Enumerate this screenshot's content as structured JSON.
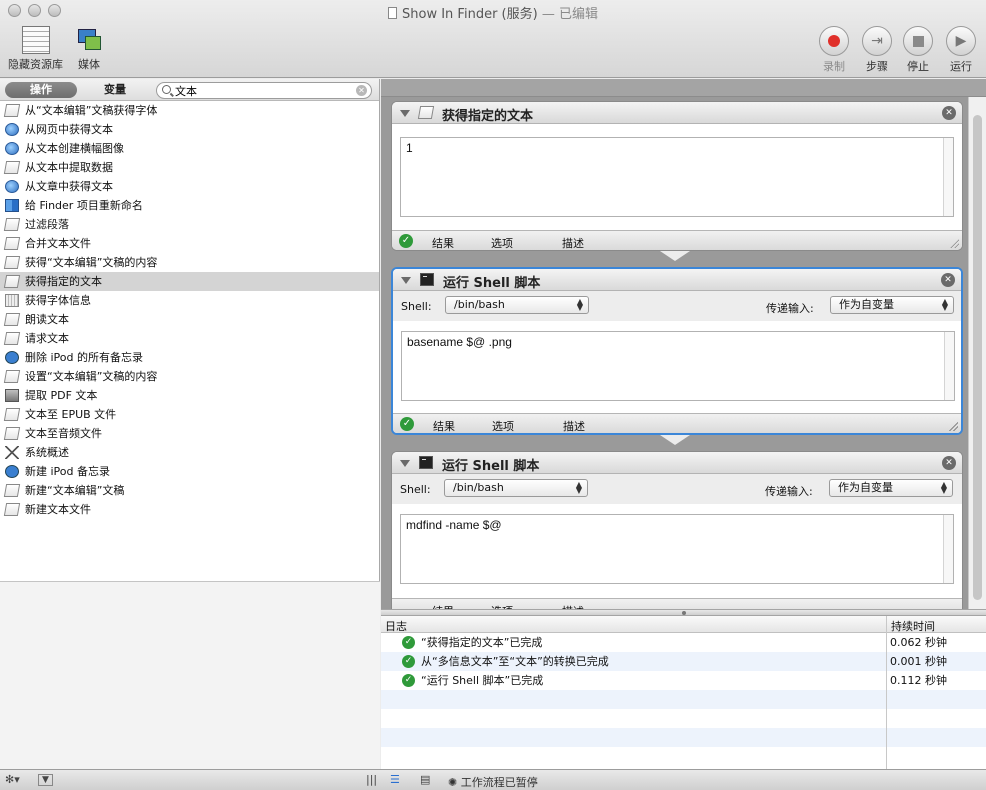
{
  "window": {
    "title": "Show In Finder (服务)",
    "subtitle": "— 已编辑"
  },
  "toolbar": {
    "left": [
      {
        "label": "隐藏资源库",
        "icon": "library-icon"
      },
      {
        "label": "媒体",
        "icon": "media-icon"
      }
    ],
    "right": [
      {
        "label": "录制",
        "icon": "record-icon"
      },
      {
        "label": "步骤",
        "icon": "step-icon"
      },
      {
        "label": "停止",
        "icon": "stop-icon"
      },
      {
        "label": "运行",
        "icon": "run-icon"
      }
    ]
  },
  "library": {
    "tabs": {
      "actions": "操作",
      "variables": "变量"
    },
    "search": {
      "value": "文本",
      "placeholder": ""
    },
    "items": [
      {
        "label": "从“文本编辑”文稿获得字体",
        "icon": "doc"
      },
      {
        "label": "从网页中获得文本",
        "icon": "globe"
      },
      {
        "label": "从文本创建横幅图像",
        "icon": "globe"
      },
      {
        "label": "从文本中提取数据",
        "icon": "doc"
      },
      {
        "label": "从文章中获得文本",
        "icon": "globe"
      },
      {
        "label": "给 Finder 项目重新命名",
        "icon": "finder"
      },
      {
        "label": "过滤段落",
        "icon": "doc"
      },
      {
        "label": "合并文本文件",
        "icon": "doc"
      },
      {
        "label": "获得“文本编辑”文稿的内容",
        "icon": "doc"
      },
      {
        "label": "获得指定的文本",
        "icon": "doc",
        "selected": true
      },
      {
        "label": "获得字体信息",
        "icon": "font"
      },
      {
        "label": "朗读文本",
        "icon": "doc"
      },
      {
        "label": "请求文本",
        "icon": "doc"
      },
      {
        "label": "删除 iPod 的所有备忘录",
        "icon": "ipod"
      },
      {
        "label": "设置“文本编辑”文稿的内容",
        "icon": "doc"
      },
      {
        "label": "提取 PDF 文本",
        "icon": "pdf"
      },
      {
        "label": "文本至 EPUB 文件",
        "icon": "doc"
      },
      {
        "label": "文本至音频文件",
        "icon": "doc"
      },
      {
        "label": "系统概述",
        "icon": "tools"
      },
      {
        "label": "新建 iPod 备忘录",
        "icon": "ipod"
      },
      {
        "label": "新建“文本编辑”文稿",
        "icon": "doc"
      },
      {
        "label": "新建文本文件",
        "icon": "doc"
      }
    ]
  },
  "workflow": {
    "actions": [
      {
        "title": "获得指定的文本",
        "content": "1",
        "footer": {
          "results": "结果",
          "options": "选项",
          "description": "描述"
        }
      },
      {
        "title": "运行 Shell 脚本",
        "shell_label": "Shell:",
        "shell_value": "/bin/bash",
        "pass_label": "传递输入:",
        "pass_value": "作为自变量",
        "content": "basename $@ .png",
        "footer": {
          "results": "结果",
          "options": "选项",
          "description": "描述"
        }
      },
      {
        "title": "运行 Shell 脚本",
        "shell_label": "Shell:",
        "shell_value": "/bin/bash",
        "pass_label": "传递输入:",
        "pass_value": "作为自变量",
        "content": "mdfind -name $@",
        "footer": {
          "results": "结果",
          "options": "选项",
          "description": "描述"
        }
      }
    ]
  },
  "log": {
    "headers": {
      "log": "日志",
      "duration": "持续时间"
    },
    "rows": [
      {
        "message": "“获得指定的文本”已完成",
        "duration": "0.062 秒钟"
      },
      {
        "message": "从“多信息文本”至“文本”的转换已完成",
        "duration": "0.001 秒钟"
      },
      {
        "message": "“运行 Shell 脚本”已完成",
        "duration": "0.112 秒钟"
      }
    ]
  },
  "statusbar": {
    "text": "工作流程已暂停"
  }
}
